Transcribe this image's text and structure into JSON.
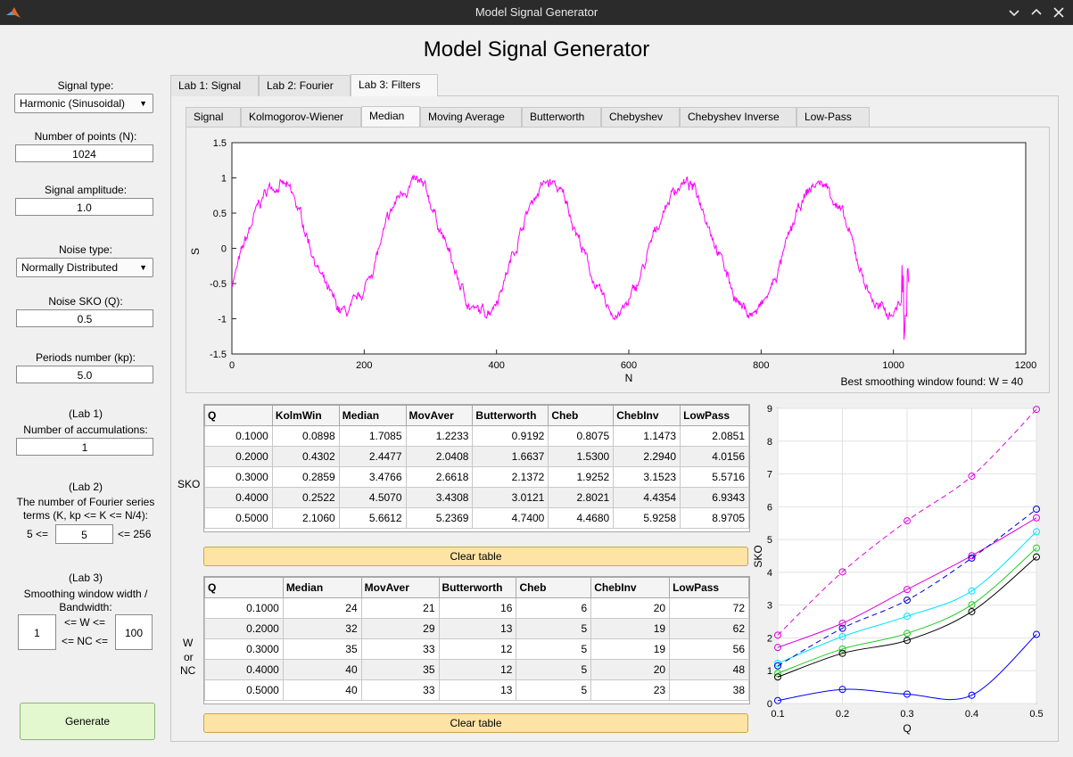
{
  "window": {
    "title": "Model Signal Generator"
  },
  "app_title": "Model Signal Generator",
  "left": {
    "signal_type_label": "Signal type:",
    "signal_type_value": "Harmonic (Sinusoidal)",
    "points_label": "Number of points (N):",
    "points_value": "1024",
    "amplitude_label": "Signal amplitude:",
    "amplitude_value": "1.0",
    "noise_type_label": "Noise type:",
    "noise_type_value": "Normally Distributed",
    "noise_sko_label": "Noise SKO (Q):",
    "noise_sko_value": "0.5",
    "periods_label": "Periods number (kp):",
    "periods_value": "5.0",
    "lab1_label": "(Lab 1)",
    "accum_label": "Number of accumulations:",
    "accum_value": "1",
    "lab2_label": "(Lab 2)",
    "fourier_label_1": "The number of Fourier series",
    "fourier_label_2": "terms (K, kp <= K <= N/4):",
    "fourier_min": "5 <=",
    "fourier_value": "5",
    "fourier_max": "<= 256",
    "lab3_label": "(Lab 3)",
    "smooth_label_1": "Smoothing window width /",
    "smooth_label_2": "Bandwidth:",
    "w_le": "<= W <=",
    "nc_le": "<= NC <=",
    "w_min_value": "1",
    "w_max_value": "100",
    "generate_label": "Generate"
  },
  "tabs": [
    "Lab 1: Signal",
    "Lab 2: Fourier",
    "Lab 3: Filters"
  ],
  "subtabs": [
    "Signal",
    "Kolmogorov-Wiener",
    "Median",
    "Moving Average",
    "Butterworth",
    "Chebyshev",
    "Chebyshev Inverse",
    "Low-Pass"
  ],
  "signal_plot": {
    "ylabel": "S",
    "xlabel": "N",
    "xticks": [
      "0",
      "200",
      "400",
      "600",
      "800",
      "1000",
      "1200"
    ],
    "yticks": [
      "1.5",
      "1",
      "0.5",
      "0",
      "-0.5",
      "-1",
      "-1.5"
    ],
    "note": "Best smoothing window found: W = 40",
    "color": "#ff00ff"
  },
  "sko_table": {
    "side_label": "SKO",
    "headers": [
      "Q",
      "KolmWin",
      "Median",
      "MovAver",
      "Butterworth",
      "Cheb",
      "ChebInv",
      "LowPass"
    ],
    "rows": [
      [
        "0.1000",
        "0.0898",
        "1.7085",
        "1.2233",
        "0.9192",
        "0.8075",
        "1.1473",
        "2.0851"
      ],
      [
        "0.2000",
        "0.4302",
        "2.4477",
        "2.0408",
        "1.6637",
        "1.5300",
        "2.2940",
        "4.0156"
      ],
      [
        "0.3000",
        "0.2859",
        "3.4766",
        "2.6618",
        "2.1372",
        "1.9252",
        "3.1523",
        "5.5716"
      ],
      [
        "0.4000",
        "0.2522",
        "4.5070",
        "3.4308",
        "3.0121",
        "2.8021",
        "4.4354",
        "6.9343"
      ],
      [
        "0.5000",
        "2.1060",
        "5.6612",
        "5.2369",
        "4.7400",
        "4.4680",
        "5.9258",
        "8.9705"
      ]
    ],
    "clear_label": "Clear table"
  },
  "w_table": {
    "side_label_1": "W",
    "side_label_2": "or",
    "side_label_3": "NC",
    "headers": [
      "Q",
      "Median",
      "MovAver",
      "Butterworth",
      "Cheb",
      "ChebInv",
      "LowPass"
    ],
    "rows": [
      [
        "0.1000",
        "24",
        "21",
        "16",
        "6",
        "20",
        "72"
      ],
      [
        "0.2000",
        "32",
        "29",
        "13",
        "5",
        "19",
        "62"
      ],
      [
        "0.3000",
        "35",
        "33",
        "12",
        "5",
        "19",
        "56"
      ],
      [
        "0.4000",
        "40",
        "35",
        "12",
        "5",
        "20",
        "48"
      ],
      [
        "0.5000",
        "40",
        "33",
        "13",
        "5",
        "23",
        "38"
      ]
    ],
    "clear_label": "Clear table"
  },
  "chart_data": {
    "type": "line",
    "xlabel": "Q",
    "ylabel": "SKO",
    "x": [
      0.1,
      0.2,
      0.3,
      0.4,
      0.5
    ],
    "xlim": [
      0.1,
      0.5
    ],
    "ylim": [
      0,
      9
    ],
    "xticks": [
      "0.1",
      "0.2",
      "0.3",
      "0.4",
      "0.5"
    ],
    "yticks": [
      "0",
      "1",
      "2",
      "3",
      "4",
      "5",
      "6",
      "7",
      "8",
      "9"
    ],
    "grid": true,
    "series": [
      {
        "values": [
          0.0898,
          0.4302,
          0.2859,
          0.2522,
          2.106
        ],
        "color": "#0000ff",
        "dash": false
      },
      {
        "values": [
          1.7085,
          2.4477,
          3.4766,
          4.507,
          5.6612
        ],
        "color": "#e000e0",
        "dash": false
      },
      {
        "values": [
          1.2233,
          2.0408,
          2.6618,
          3.4308,
          5.2369
        ],
        "color": "#00e5ff",
        "dash": false
      },
      {
        "values": [
          0.9192,
          1.6637,
          2.1372,
          3.0121,
          4.74
        ],
        "color": "#22cc22",
        "dash": false
      },
      {
        "values": [
          0.8075,
          1.53,
          1.9252,
          2.8021,
          4.468
        ],
        "color": "#000000",
        "dash": false
      },
      {
        "values": [
          1.1473,
          2.294,
          3.1523,
          4.4354,
          5.9258
        ],
        "color": "#0000cc",
        "dash": true
      },
      {
        "values": [
          2.0851,
          4.0156,
          5.5716,
          6.9343,
          8.9705
        ],
        "color": "#e000e0",
        "dash": true
      }
    ]
  }
}
